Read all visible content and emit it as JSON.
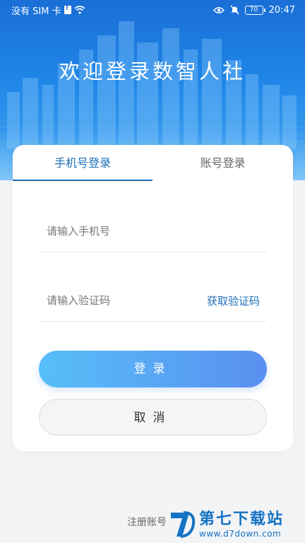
{
  "status_bar": {
    "carrier": "没有 SIM 卡",
    "battery": "70",
    "time": "20:47",
    "icons": [
      "sim-alert-icon",
      "wifi-icon",
      "eye-icon",
      "mute-icon",
      "battery-icon"
    ]
  },
  "header": {
    "title": "欢迎登录数智人社"
  },
  "tabs": {
    "phone_login": "手机号登录",
    "account_login": "账号登录"
  },
  "form": {
    "phone_placeholder": "请输入手机号",
    "code_placeholder": "请输入验证码",
    "get_code": "获取验证码",
    "login_button": "登录",
    "cancel_button": "取消"
  },
  "footer": {
    "register": "注册账号"
  },
  "watermark": {
    "name": "第七下载站",
    "url": "www.d7down.com"
  },
  "colors": {
    "accent": "#1f6fb8",
    "banner_top": "#1a6fd6",
    "login_gradient_start": "#56bff8",
    "login_gradient_end": "#5a8ff0"
  }
}
